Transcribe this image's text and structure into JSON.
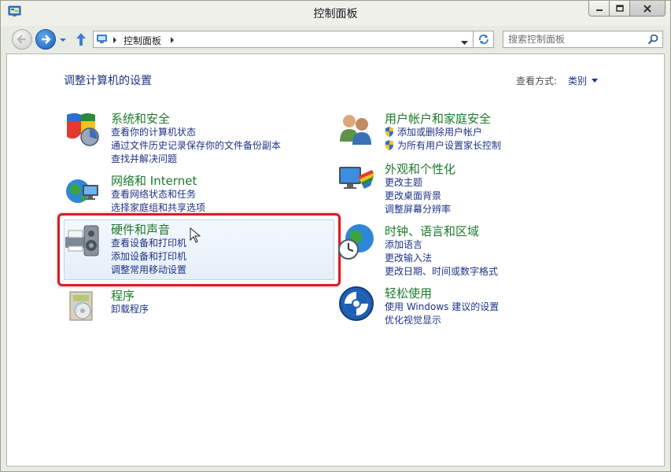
{
  "window": {
    "title": "控制面板"
  },
  "nav": {
    "address_path": "控制面板",
    "search_placeholder": "搜索控制面板"
  },
  "content": {
    "heading": "调整计算机的设置",
    "view_by_label": "查看方式:",
    "view_by_value": "类别"
  },
  "categories": [
    {
      "title": "系统和安全",
      "links": [
        "查看你的计算机状态",
        "通过文件历史记录保存你的文件备份副本",
        "查找并解决问题"
      ]
    },
    {
      "title": "网络和 Internet",
      "links": [
        "查看网络状态和任务",
        "选择家庭组和共享选项"
      ]
    },
    {
      "title": "硬件和声音",
      "links": [
        "查看设备和打印机",
        "添加设备和打印机",
        "调整常用移动设置"
      ]
    },
    {
      "title": "程序",
      "links": [
        "卸载程序"
      ]
    },
    {
      "title": "用户帐户和家庭安全",
      "links": [
        "添加或删除用户帐户",
        "为所有用户设置家长控制"
      ]
    },
    {
      "title": "外观和个性化",
      "links": [
        "更改主题",
        "更改桌面背景",
        "调整屏幕分辨率"
      ]
    },
    {
      "title": "时钟、语言和区域",
      "links": [
        "添加语言",
        "更改输入法",
        "更改日期、时间或数字格式"
      ]
    },
    {
      "title": "轻松使用",
      "links": [
        "使用 Windows 建议的设置",
        "优化视觉显示"
      ]
    }
  ],
  "colors": {
    "category_title": "#1d7a2b",
    "link": "#1e3287",
    "highlight_border": "#d31f27"
  }
}
